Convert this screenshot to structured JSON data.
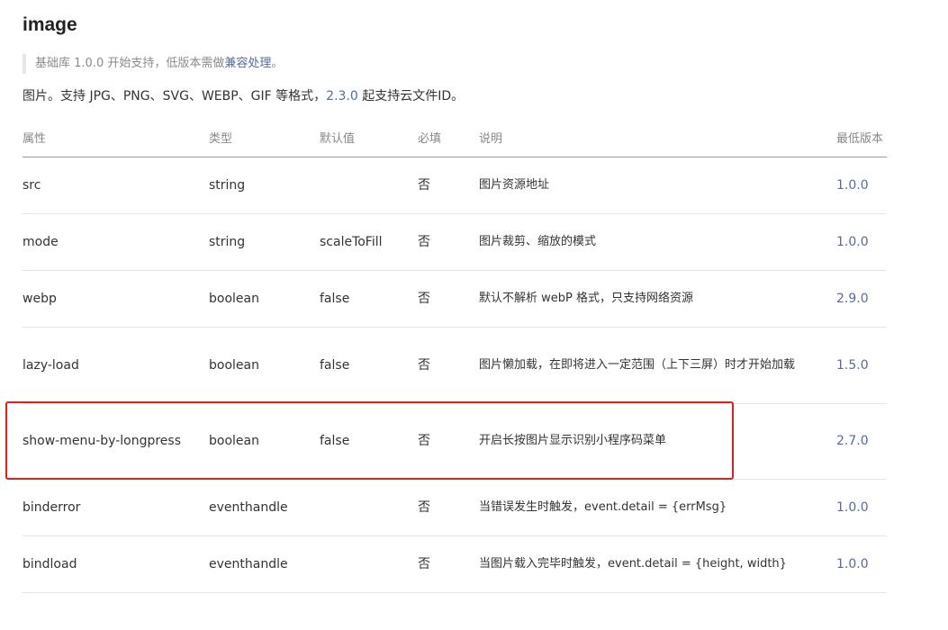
{
  "title": "image",
  "tip": {
    "text": "基础库 1.0.0 开始支持，低版本需做",
    "link": "兼容处理",
    "suffix": "。"
  },
  "description": {
    "text": "图片。支持 JPG、PNG、SVG、WEBP、GIF 等格式，",
    "version": "2.3.0",
    "suffix": " 起支持云文件ID。"
  },
  "table": {
    "headers": [
      "属性",
      "类型",
      "默认值",
      "必填",
      "说明",
      "最低版本"
    ],
    "rows": [
      {
        "attr": "src",
        "type": "string",
        "default": "",
        "required": "否",
        "desc": "图片资源地址",
        "version": "1.0.0"
      },
      {
        "attr": "mode",
        "type": "string",
        "default": "scaleToFill",
        "required": "否",
        "desc": "图片裁剪、缩放的模式",
        "version": "1.0.0"
      },
      {
        "attr": "webp",
        "type": "boolean",
        "default": "false",
        "required": "否",
        "desc": "默认不解析 webP 格式，只支持网络资源",
        "version": "2.9.0"
      },
      {
        "attr": "lazy-load",
        "type": "boolean",
        "default": "false",
        "required": "否",
        "desc": "图片懒加载，在即将进入一定范围（上下三屏）时才开始加载",
        "version": "1.5.0"
      },
      {
        "attr": "show-menu-by-longpress",
        "type": "boolean",
        "default": "false",
        "required": "否",
        "desc": "开启长按图片显示识别小程序码菜单",
        "version": "2.7.0"
      },
      {
        "attr": "binderror",
        "type": "eventhandle",
        "default": "",
        "required": "否",
        "desc": "当错误发生时触发，event.detail = {errMsg}",
        "version": "1.0.0"
      },
      {
        "attr": "bindload",
        "type": "eventhandle",
        "default": "",
        "required": "否",
        "desc": "当图片载入完毕时触发，event.detail = {height, width}",
        "version": "1.0.0"
      }
    ]
  },
  "colors": {
    "link": "#576b95",
    "highlight": "#e02020"
  }
}
